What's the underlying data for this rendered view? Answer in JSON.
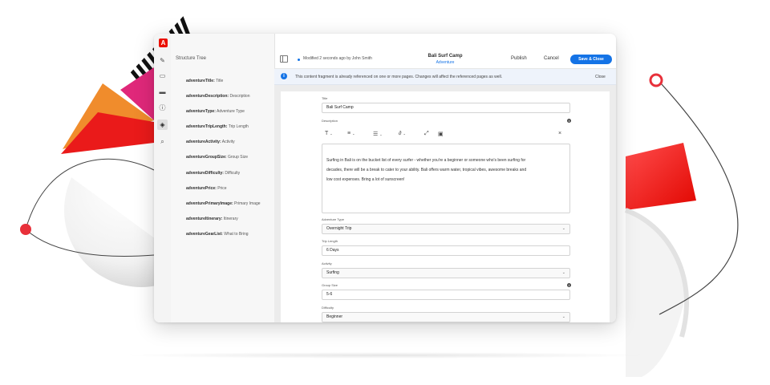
{
  "app": {
    "logo_letter": "A",
    "brand_color": "#eb1000",
    "accent_color": "#1473e6"
  },
  "rail": {
    "icons": [
      "pencil-icon",
      "comment-icon",
      "folder-icon",
      "info-icon",
      "layers-icon",
      "variation-icon"
    ]
  },
  "structure_tree": {
    "title": "Structure Tree",
    "items": [
      {
        "name": "adventureTitle:",
        "label": "Title"
      },
      {
        "name": "adventureDescription:",
        "label": "Description"
      },
      {
        "name": "adventureType:",
        "label": "Adventure Type"
      },
      {
        "name": "adventureTripLength:",
        "label": "Trip Length"
      },
      {
        "name": "adventureActivity:",
        "label": "Activity"
      },
      {
        "name": "adventureGroupSize:",
        "label": "Group Size"
      },
      {
        "name": "adventureDifficulty:",
        "label": "Difficulty"
      },
      {
        "name": "adventurePrice:",
        "label": "Price"
      },
      {
        "name": "adventurePrimaryImage:",
        "label": "Primary Image"
      },
      {
        "name": "adventureItinerary:",
        "label": "Itinerary"
      },
      {
        "name": "adventureGearList:",
        "label": "What to Bring"
      }
    ]
  },
  "header": {
    "modified": "Modified 2 seconds ago by John Smith",
    "fragment_title": "Bali Surf Camp",
    "fragment_model": "Adventure",
    "publish": "Publish",
    "cancel": "Cancel",
    "save_close": "Save & Close"
  },
  "banner": {
    "message": "This content fragment is already referenced on one or more pages. Changes will affect the referenced pages as well.",
    "close": "Close"
  },
  "form": {
    "title_label": "Title",
    "title_value": "Bali Surf Camp",
    "description_label": "Description",
    "description_lines": [
      "Surfing in Bali is on the bucket list of every surfer - whether you're a beginner or someone who's been surfing for",
      "decades, there will be a break to cater to your ability. Bali offers warm water, tropical vibes, awesome breaks and",
      "low cost expenses. Bring a lot of sunscreen!"
    ],
    "toolbar": {
      "text": "T",
      "align": "≡",
      "list": "☰",
      "link": "∂",
      "expand": "⤢",
      "image": "▣",
      "clear": "×"
    },
    "adventure_type_label": "Adventure Type",
    "adventure_type_value": "Overnight Trip",
    "trip_length_label": "Trip Length",
    "trip_length_value": "6 Days",
    "activity_label": "Activity",
    "activity_value": "Surfing",
    "group_size_label": "Group Size",
    "group_size_value": "5-6",
    "difficulty_label": "Difficulty",
    "difficulty_value": "Beginner"
  }
}
